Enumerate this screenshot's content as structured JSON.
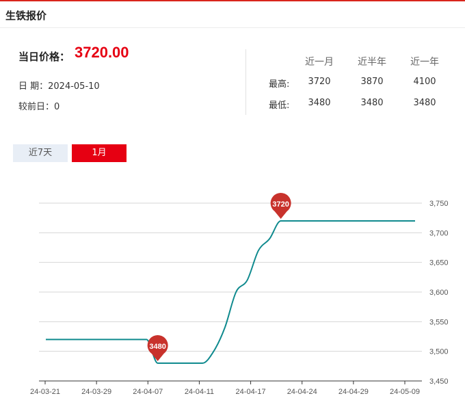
{
  "header": {
    "title": "生铁报价"
  },
  "summary": {
    "price_label": "当日价格：",
    "price_value": "3720.00",
    "date_line": "日 期：2024-05-10",
    "change_line": "较前日：0"
  },
  "stats": {
    "columns": [
      "近一月",
      "近半年",
      "近一年"
    ],
    "rows": [
      {
        "label": "最高:",
        "values": [
          "3720",
          "3870",
          "4100"
        ]
      },
      {
        "label": "最低:",
        "values": [
          "3480",
          "3480",
          "3480"
        ]
      }
    ]
  },
  "tabs": [
    {
      "label": "近7天",
      "active": false
    },
    {
      "label": "1月",
      "active": true
    }
  ],
  "colors": {
    "accent": "#e60012",
    "line": "#0f8a8e",
    "marker": "#c8322c"
  },
  "chart_data": {
    "type": "line",
    "xlabel": "",
    "ylabel": "",
    "ylim": [
      3450,
      3750
    ],
    "yticks": [
      3450,
      3500,
      3550,
      3600,
      3650,
      3700,
      3750
    ],
    "ytick_labels": [
      "3,450",
      "3,500",
      "3,550",
      "3,600",
      "3,650",
      "3,700",
      "3,750"
    ],
    "xtick_labels": [
      "24-03-21",
      "24-03-29",
      "24-04-07",
      "24-04-11",
      "24-04-17",
      "24-04-24",
      "24-04-29",
      "24-05-09"
    ],
    "grid": true,
    "x": [
      "03-21",
      "03-22",
      "03-25",
      "03-26",
      "03-27",
      "03-28",
      "03-29",
      "04-01",
      "04-02",
      "04-03",
      "04-07",
      "04-08",
      "04-09",
      "04-10",
      "04-11",
      "04-12",
      "04-15",
      "04-16",
      "04-17",
      "04-18",
      "04-19",
      "04-22",
      "04-23",
      "04-24",
      "04-25",
      "04-26",
      "04-28",
      "04-29",
      "04-30",
      "05-06",
      "05-07",
      "05-08",
      "05-09",
      "05-10"
    ],
    "series": [
      {
        "values": [
          3520,
          3520,
          3520,
          3520,
          3520,
          3520,
          3520,
          3520,
          3520,
          3520,
          3480,
          3480,
          3480,
          3480,
          3480,
          3500,
          3540,
          3600,
          3620,
          3670,
          3690,
          3720,
          3720,
          3720,
          3720,
          3720,
          3720,
          3720,
          3720,
          3720,
          3720,
          3720,
          3720,
          3720
        ]
      }
    ],
    "annotations": [
      {
        "label": "3480",
        "index": 10,
        "value": 3480
      },
      {
        "label": "3720",
        "index": 21,
        "value": 3720
      }
    ]
  }
}
